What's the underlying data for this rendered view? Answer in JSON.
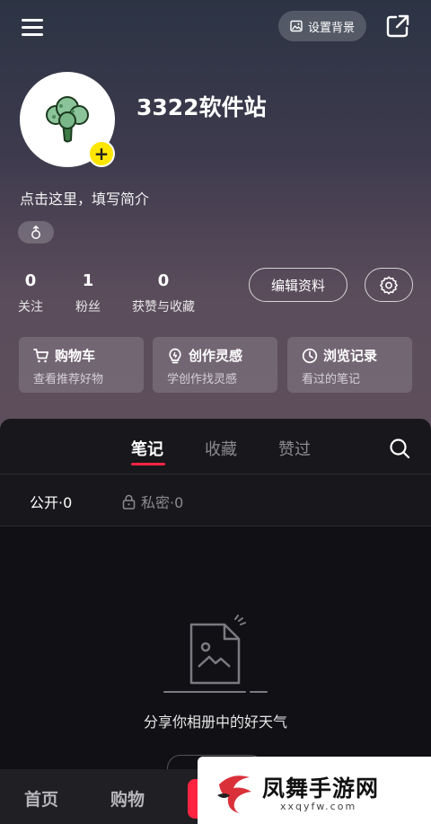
{
  "header": {
    "set_background_label": "设置背景"
  },
  "profile": {
    "username": "3322软件站",
    "bio": "点击这里，填写简介"
  },
  "stats": [
    {
      "value": "0",
      "label": "关注"
    },
    {
      "value": "1",
      "label": "粉丝"
    },
    {
      "value": "0",
      "label": "获赞与收藏"
    }
  ],
  "edit_profile_label": "编辑资料",
  "cards": [
    {
      "title": "购物车",
      "subtitle": "查看推荐好物",
      "icon": "cart-icon"
    },
    {
      "title": "创作灵感",
      "subtitle": "学创作找灵感",
      "icon": "bulb-icon"
    },
    {
      "title": "浏览记录",
      "subtitle": "看过的笔记",
      "icon": "clock-icon"
    }
  ],
  "tabs": [
    {
      "label": "笔记",
      "active": true
    },
    {
      "label": "收藏",
      "active": false
    },
    {
      "label": "赞过",
      "active": false
    }
  ],
  "subtabs": {
    "public": "公开·0",
    "private": "私密·0"
  },
  "empty_state": {
    "message": "分享你相册中的好天气"
  },
  "bottom_nav": {
    "home": "首页",
    "shopping": "购物"
  },
  "watermark": {
    "name": "凤舞手游网",
    "url": "xxqyfw.com"
  },
  "colors": {
    "accent": "#ff2442",
    "avatar_badge": "#ffe600"
  }
}
